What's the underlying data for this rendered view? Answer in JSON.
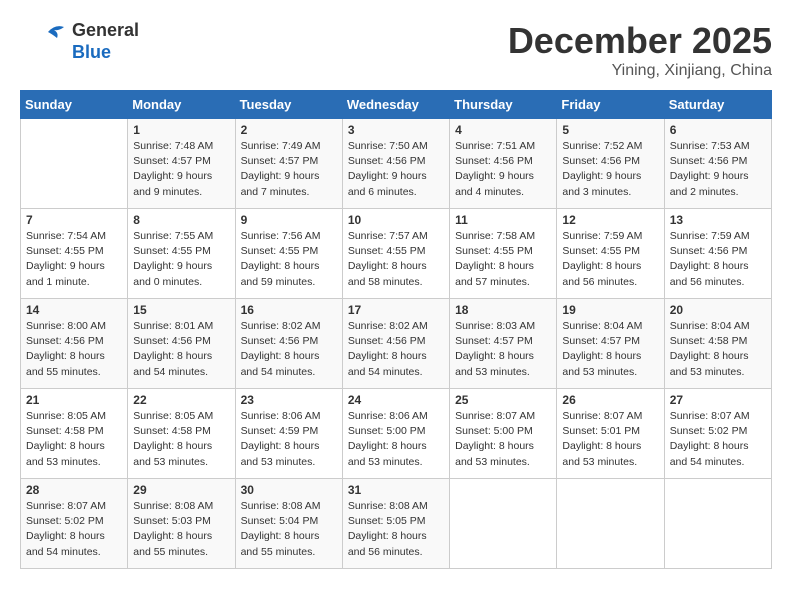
{
  "header": {
    "logo_line1": "General",
    "logo_line2": "Blue",
    "month": "December 2025",
    "location": "Yining, Xinjiang, China"
  },
  "weekdays": [
    "Sunday",
    "Monday",
    "Tuesday",
    "Wednesday",
    "Thursday",
    "Friday",
    "Saturday"
  ],
  "weeks": [
    [
      {
        "num": "",
        "info": ""
      },
      {
        "num": "1",
        "info": "Sunrise: 7:48 AM\nSunset: 4:57 PM\nDaylight: 9 hours\nand 9 minutes."
      },
      {
        "num": "2",
        "info": "Sunrise: 7:49 AM\nSunset: 4:57 PM\nDaylight: 9 hours\nand 7 minutes."
      },
      {
        "num": "3",
        "info": "Sunrise: 7:50 AM\nSunset: 4:56 PM\nDaylight: 9 hours\nand 6 minutes."
      },
      {
        "num": "4",
        "info": "Sunrise: 7:51 AM\nSunset: 4:56 PM\nDaylight: 9 hours\nand 4 minutes."
      },
      {
        "num": "5",
        "info": "Sunrise: 7:52 AM\nSunset: 4:56 PM\nDaylight: 9 hours\nand 3 minutes."
      },
      {
        "num": "6",
        "info": "Sunrise: 7:53 AM\nSunset: 4:56 PM\nDaylight: 9 hours\nand 2 minutes."
      }
    ],
    [
      {
        "num": "7",
        "info": "Sunrise: 7:54 AM\nSunset: 4:55 PM\nDaylight: 9 hours\nand 1 minute."
      },
      {
        "num": "8",
        "info": "Sunrise: 7:55 AM\nSunset: 4:55 PM\nDaylight: 9 hours\nand 0 minutes."
      },
      {
        "num": "9",
        "info": "Sunrise: 7:56 AM\nSunset: 4:55 PM\nDaylight: 8 hours\nand 59 minutes."
      },
      {
        "num": "10",
        "info": "Sunrise: 7:57 AM\nSunset: 4:55 PM\nDaylight: 8 hours\nand 58 minutes."
      },
      {
        "num": "11",
        "info": "Sunrise: 7:58 AM\nSunset: 4:55 PM\nDaylight: 8 hours\nand 57 minutes."
      },
      {
        "num": "12",
        "info": "Sunrise: 7:59 AM\nSunset: 4:55 PM\nDaylight: 8 hours\nand 56 minutes."
      },
      {
        "num": "13",
        "info": "Sunrise: 7:59 AM\nSunset: 4:56 PM\nDaylight: 8 hours\nand 56 minutes."
      }
    ],
    [
      {
        "num": "14",
        "info": "Sunrise: 8:00 AM\nSunset: 4:56 PM\nDaylight: 8 hours\nand 55 minutes."
      },
      {
        "num": "15",
        "info": "Sunrise: 8:01 AM\nSunset: 4:56 PM\nDaylight: 8 hours\nand 54 minutes."
      },
      {
        "num": "16",
        "info": "Sunrise: 8:02 AM\nSunset: 4:56 PM\nDaylight: 8 hours\nand 54 minutes."
      },
      {
        "num": "17",
        "info": "Sunrise: 8:02 AM\nSunset: 4:56 PM\nDaylight: 8 hours\nand 54 minutes."
      },
      {
        "num": "18",
        "info": "Sunrise: 8:03 AM\nSunset: 4:57 PM\nDaylight: 8 hours\nand 53 minutes."
      },
      {
        "num": "19",
        "info": "Sunrise: 8:04 AM\nSunset: 4:57 PM\nDaylight: 8 hours\nand 53 minutes."
      },
      {
        "num": "20",
        "info": "Sunrise: 8:04 AM\nSunset: 4:58 PM\nDaylight: 8 hours\nand 53 minutes."
      }
    ],
    [
      {
        "num": "21",
        "info": "Sunrise: 8:05 AM\nSunset: 4:58 PM\nDaylight: 8 hours\nand 53 minutes."
      },
      {
        "num": "22",
        "info": "Sunrise: 8:05 AM\nSunset: 4:58 PM\nDaylight: 8 hours\nand 53 minutes."
      },
      {
        "num": "23",
        "info": "Sunrise: 8:06 AM\nSunset: 4:59 PM\nDaylight: 8 hours\nand 53 minutes."
      },
      {
        "num": "24",
        "info": "Sunrise: 8:06 AM\nSunset: 5:00 PM\nDaylight: 8 hours\nand 53 minutes."
      },
      {
        "num": "25",
        "info": "Sunrise: 8:07 AM\nSunset: 5:00 PM\nDaylight: 8 hours\nand 53 minutes."
      },
      {
        "num": "26",
        "info": "Sunrise: 8:07 AM\nSunset: 5:01 PM\nDaylight: 8 hours\nand 53 minutes."
      },
      {
        "num": "27",
        "info": "Sunrise: 8:07 AM\nSunset: 5:02 PM\nDaylight: 8 hours\nand 54 minutes."
      }
    ],
    [
      {
        "num": "28",
        "info": "Sunrise: 8:07 AM\nSunset: 5:02 PM\nDaylight: 8 hours\nand 54 minutes."
      },
      {
        "num": "29",
        "info": "Sunrise: 8:08 AM\nSunset: 5:03 PM\nDaylight: 8 hours\nand 55 minutes."
      },
      {
        "num": "30",
        "info": "Sunrise: 8:08 AM\nSunset: 5:04 PM\nDaylight: 8 hours\nand 55 minutes."
      },
      {
        "num": "31",
        "info": "Sunrise: 8:08 AM\nSunset: 5:05 PM\nDaylight: 8 hours\nand 56 minutes."
      },
      {
        "num": "",
        "info": ""
      },
      {
        "num": "",
        "info": ""
      },
      {
        "num": "",
        "info": ""
      }
    ]
  ]
}
